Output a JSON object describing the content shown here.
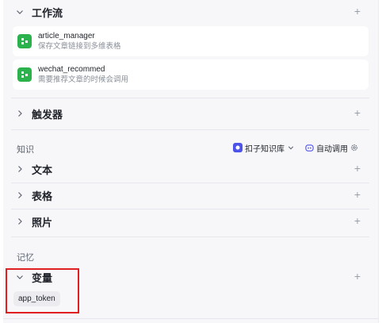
{
  "workflow": {
    "title": "工作流",
    "items": [
      {
        "name": "article_manager",
        "desc": "保存文章链接到多维表格"
      },
      {
        "name": "wechat_recommed",
        "desc": "需要推荐文章的时候会调用"
      }
    ]
  },
  "trigger": {
    "title": "触发器"
  },
  "knowledge": {
    "title": "知识",
    "kb_selector_label": "扣子知识库",
    "auto_call_label": "自动调用",
    "items": [
      {
        "title": "文本"
      },
      {
        "title": "表格"
      },
      {
        "title": "照片"
      }
    ]
  },
  "memory": {
    "title": "记忆",
    "variables": {
      "title": "变量",
      "tags": [
        "app_token"
      ]
    }
  },
  "icons": {
    "collapse": "chevron-down-icon",
    "expand": "chevron-right-icon",
    "add": "plus-icon",
    "workflow": "workflow-icon",
    "kb": "knowledge-base-icon",
    "auto": "auto-call-icon",
    "settings": "gear-icon"
  },
  "colors": {
    "workflow_icon": "#2bb24c",
    "accent": "#4d53e8",
    "highlight": "#e02020"
  }
}
